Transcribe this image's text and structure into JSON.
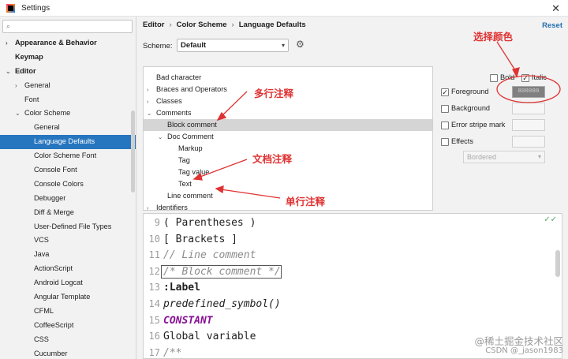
{
  "window": {
    "title": "Settings"
  },
  "search": {
    "value": "",
    "placeholder": ""
  },
  "sidebar": {
    "items": [
      {
        "label": "Appearance & Behavior",
        "level": 0,
        "arrow": "›",
        "bold": true
      },
      {
        "label": "Keymap",
        "level": 0,
        "arrow": "",
        "bold": true
      },
      {
        "label": "Editor",
        "level": 0,
        "arrow": "⌄",
        "bold": true
      },
      {
        "label": "General",
        "level": 1,
        "arrow": "›"
      },
      {
        "label": "Font",
        "level": 1,
        "arrow": ""
      },
      {
        "label": "Color Scheme",
        "level": 1,
        "arrow": "⌄"
      },
      {
        "label": "General",
        "level": 2,
        "arrow": ""
      },
      {
        "label": "Language Defaults",
        "level": 2,
        "arrow": "",
        "selected": true
      },
      {
        "label": "Color Scheme Font",
        "level": 2,
        "arrow": ""
      },
      {
        "label": "Console Font",
        "level": 2,
        "arrow": ""
      },
      {
        "label": "Console Colors",
        "level": 2,
        "arrow": ""
      },
      {
        "label": "Debugger",
        "level": 2,
        "arrow": ""
      },
      {
        "label": "Diff & Merge",
        "level": 2,
        "arrow": ""
      },
      {
        "label": "User-Defined File Types",
        "level": 2,
        "arrow": ""
      },
      {
        "label": "VCS",
        "level": 2,
        "arrow": ""
      },
      {
        "label": "Java",
        "level": 2,
        "arrow": ""
      },
      {
        "label": "ActionScript",
        "level": 2,
        "arrow": ""
      },
      {
        "label": "Android Logcat",
        "level": 2,
        "arrow": ""
      },
      {
        "label": "Angular Template",
        "level": 2,
        "arrow": ""
      },
      {
        "label": "CFML",
        "level": 2,
        "arrow": ""
      },
      {
        "label": "CoffeeScript",
        "level": 2,
        "arrow": ""
      },
      {
        "label": "CSS",
        "level": 2,
        "arrow": ""
      },
      {
        "label": "Cucumber",
        "level": 2,
        "arrow": ""
      }
    ]
  },
  "breadcrumb": [
    "Editor",
    "Color Scheme",
    "Language Defaults"
  ],
  "breadcrumb_sep": "›",
  "reset_label": "Reset",
  "scheme": {
    "label": "Scheme:",
    "value": "Default"
  },
  "elements": [
    {
      "label": "Bad character",
      "level": 0,
      "arrow": ""
    },
    {
      "label": "Braces and Operators",
      "level": 0,
      "arrow": "›"
    },
    {
      "label": "Classes",
      "level": 0,
      "arrow": "›"
    },
    {
      "label": "Comments",
      "level": 0,
      "arrow": "⌄"
    },
    {
      "label": "Block comment",
      "level": 1,
      "arrow": "",
      "selected": true
    },
    {
      "label": "Doc Comment",
      "level": 1,
      "arrow": "⌄"
    },
    {
      "label": "Markup",
      "level": 2,
      "arrow": ""
    },
    {
      "label": "Tag",
      "level": 2,
      "arrow": ""
    },
    {
      "label": "Tag value",
      "level": 2,
      "arrow": ""
    },
    {
      "label": "Text",
      "level": 2,
      "arrow": ""
    },
    {
      "label": "Line comment",
      "level": 1,
      "arrow": ""
    },
    {
      "label": "Identifiers",
      "level": 0,
      "arrow": "›"
    }
  ],
  "attributes": {
    "bold_label": "Bold",
    "bold_checked": false,
    "italic_label": "Italic",
    "italic_checked": true,
    "foreground_label": "Foreground",
    "foreground_checked": true,
    "foreground_value": "808080",
    "background_label": "Background",
    "error_stripe_label": "Error stripe mark",
    "effects_label": "Effects",
    "effects_value": "Bordered"
  },
  "code_lines": [
    {
      "num": "9",
      "text": "( Parentheses )",
      "style": "plain"
    },
    {
      "num": "10",
      "text": "[ Brackets ]",
      "style": "plain"
    },
    {
      "num": "11",
      "text": "// Line comment",
      "style": "comment"
    },
    {
      "num": "12",
      "text": "/* Block comment */",
      "style": "block"
    },
    {
      "num": "13",
      "text": ":Label",
      "style": "label"
    },
    {
      "num": "14",
      "text": "predefined_symbol()",
      "style": "italic"
    },
    {
      "num": "15",
      "text": "CONSTANT",
      "style": "const"
    },
    {
      "num": "16",
      "text": "Global variable",
      "style": "plain"
    },
    {
      "num": "17",
      "text": "/**",
      "style": "comment"
    }
  ],
  "annotations": {
    "choose_color": "选择颜色",
    "multiline_comment": "多行注释",
    "doc_comment": "文档注释",
    "single_line_comment": "单行注释"
  },
  "watermark": {
    "line1": "@稀土掘金技术社区",
    "line2": "CSDN @_jason1983"
  },
  "colors": {
    "selection": "#2675bf",
    "annotation": "#e03232",
    "link": "#2470b3",
    "constant": "#871094",
    "comment": "#8c8c8c"
  }
}
